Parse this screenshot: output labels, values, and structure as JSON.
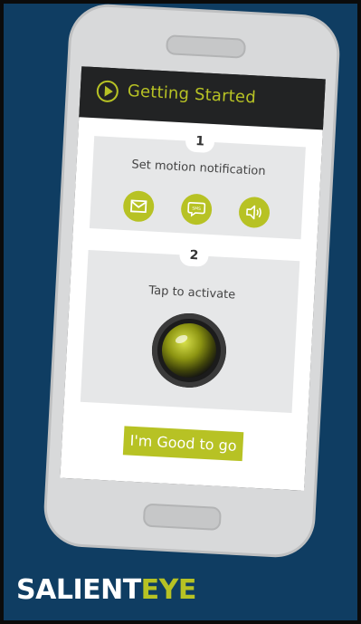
{
  "app": {
    "title": "Getting Started"
  },
  "steps": [
    {
      "number": "1",
      "title": "Set motion notification",
      "icons": [
        "mail-icon",
        "sms-icon",
        "speaker-icon"
      ],
      "sms_icon_text": "SMS"
    },
    {
      "number": "2",
      "title": "Tap to activate"
    }
  ],
  "button": {
    "label": "I'm Good to go"
  },
  "brand": {
    "left": "SALIENT",
    "right": "EYE"
  },
  "colors": {
    "accent": "#b7c224",
    "background": "#0f3d62",
    "phone_body": "#d8d9da",
    "topbar": "#222324"
  }
}
